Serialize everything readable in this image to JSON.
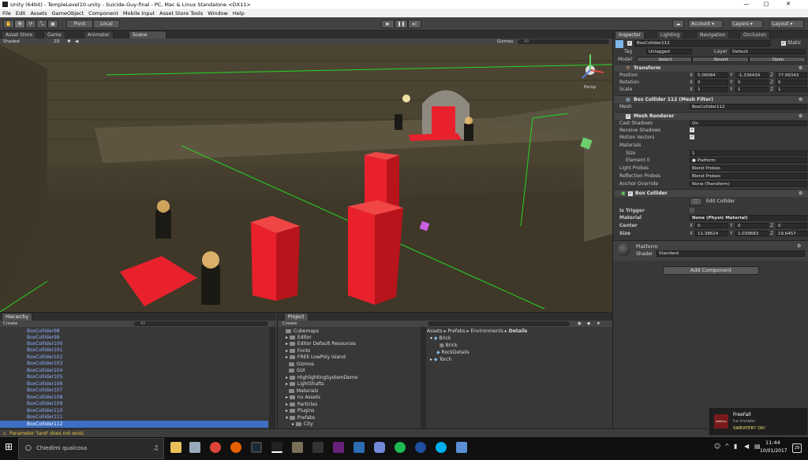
{
  "window": {
    "title": "Unity (64bit) - TempleLevel10.unity - Suicide-Guy-final - PC, Mac & Linux Standalone <DX11>",
    "min": "—",
    "max": "□",
    "close": "✕"
  },
  "menu": [
    "File",
    "Edit",
    "Assets",
    "GameObject",
    "Component",
    "Mobile Input",
    "Asset Store Tools",
    "Window",
    "Help"
  ],
  "toolbar": {
    "pivot": "Pivot",
    "local": "Local",
    "account": "Account",
    "layers": "Layers",
    "layout": "Layout"
  },
  "scene_tabs": [
    "Asset Store",
    "Game",
    "Animator",
    "Scene"
  ],
  "scene_toolbar": {
    "shading": "Shaded",
    "mode2d": "2D",
    "gizmos": "Gizmos",
    "search": "All"
  },
  "scene_gizmo": {
    "persp": "Persp"
  },
  "inspector": {
    "tabs": [
      "Inspector",
      "Lighting",
      "Navigation",
      "Occlusion"
    ],
    "object_name": "BoxCollider112",
    "static_label": "Static",
    "tag_label": "Tag",
    "tag_value": "Untagged",
    "layer_label": "Layer",
    "layer_value": "Default",
    "model_label": "Model",
    "model_select": "Select",
    "model_revert": "Revert",
    "model_open": "Open",
    "transform": {
      "title": "Transform",
      "rows": [
        {
          "label": "Position",
          "x": "5.06084",
          "y": "-1.336434",
          "z": "77.99343"
        },
        {
          "label": "Rotation",
          "x": "0",
          "y": "0",
          "z": "0"
        },
        {
          "label": "Scale",
          "x": "1",
          "y": "1",
          "z": "1"
        }
      ]
    },
    "mesh_filter": {
      "title": "Box Collider 112 (Mesh Filter)",
      "mesh_label": "Mesh",
      "mesh_value": "BoxCollider112"
    },
    "mesh_renderer": {
      "title": "Mesh Renderer",
      "cast_shadows_label": "Cast Shadows",
      "cast_shadows_value": "On",
      "receive_shadows_label": "Receive Shadows",
      "motion_vectors_label": "Motion Vectors",
      "materials_label": "Materials",
      "size_label": "Size",
      "size_value": "1",
      "element0_label": "Element 0",
      "element0_value": "Platform",
      "light_probes_label": "Light Probes",
      "light_probes_value": "Blend Probes",
      "reflection_probes_label": "Reflection Probes",
      "reflection_probes_value": "Blend Probes",
      "anchor_label": "Anchor Override",
      "anchor_value": "None (Transform)"
    },
    "box_collider": {
      "title": "Box Collider",
      "edit_label": "Edit Collider",
      "is_trigger_label": "Is Trigger",
      "material_label": "Material",
      "material_value": "None (Physic Material)",
      "center_label": "Center",
      "center": {
        "x": "0",
        "y": "0",
        "z": "0"
      },
      "size_label": "Size",
      "size": {
        "x": "11.38624",
        "y": "1.039683",
        "z": "19.6457"
      }
    },
    "material": {
      "name": "Platform",
      "shader_label": "Shader",
      "shader_value": "Standard"
    },
    "add_component": "Add Component"
  },
  "hierarchy": {
    "tab": "Hierarchy",
    "create": "Create",
    "search": "All",
    "items": [
      "BoxCollider98",
      "BoxCollider99",
      "BoxCollider100",
      "BoxCollider101",
      "BoxCollider102",
      "BoxCollider103",
      "BoxCollider104",
      "BoxCollider105",
      "BoxCollider106",
      "BoxCollider107",
      "BoxCollider108",
      "BoxCollider109",
      "BoxCollider110",
      "BoxCollider111",
      "BoxCollider112"
    ]
  },
  "project": {
    "tab": "Project",
    "create": "Create",
    "folders": [
      "Cubemaps",
      "Editor",
      "Editor Default Resources",
      "Fonts",
      "FREE LowPoly Island",
      "Gizmos",
      "GUI",
      "HighlightingSystemDemo",
      "LightShafts",
      "Materials",
      "nu Assets",
      "Particles",
      "Plugins",
      "Prefabs",
      "City"
    ],
    "breadcrumb": [
      "Assets",
      "Prefabs",
      "Environments",
      "Details"
    ],
    "assets": [
      "Brick",
      "Brick",
      "RockDetails",
      "Torch"
    ]
  },
  "status": {
    "warning": "Parameter 'land' does not exist."
  },
  "notification": {
    "app": "FreeFall",
    "line1": "ha inviato:",
    "line2": "SWEATER? OK!",
    "thumb": "FREEFALL"
  },
  "taskbar": {
    "search": "Chiedimi qualcosa",
    "time": "11:44",
    "date": "10/01/2017",
    "badge": "29"
  },
  "colors": {
    "accent": "#3d6fc4",
    "red_box": "#e8212c",
    "green_line": "#25d625"
  }
}
